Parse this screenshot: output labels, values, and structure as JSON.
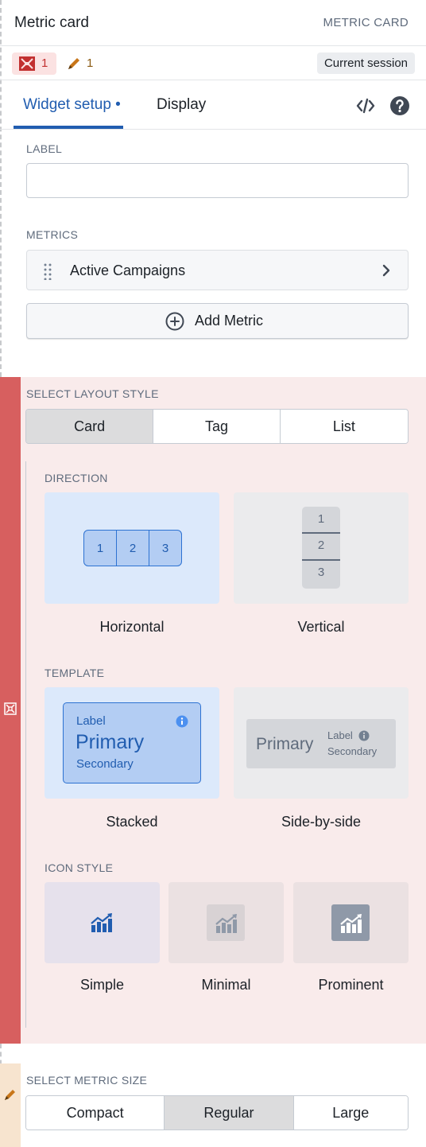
{
  "header": {
    "title": "Metric card",
    "type_label": "METRIC CARD"
  },
  "status": {
    "error_count": "1",
    "edit_count": "1",
    "session_label": "Current session"
  },
  "tabs": [
    {
      "label": "Widget setup •"
    },
    {
      "label": "Display"
    }
  ],
  "label_section": {
    "heading": "LABEL",
    "value": ""
  },
  "metrics_section": {
    "heading": "METRICS",
    "items": [
      {
        "name": "Active Campaigns"
      }
    ],
    "add_label": "Add Metric"
  },
  "layout_style": {
    "heading": "SELECT LAYOUT STYLE",
    "options": [
      "Card",
      "Tag",
      "List"
    ],
    "selected": "Card"
  },
  "direction": {
    "heading": "DIRECTION",
    "horizontal_label": "Horizontal",
    "vertical_label": "Vertical",
    "cells": [
      "1",
      "2",
      "3"
    ],
    "selected": "Horizontal"
  },
  "template": {
    "heading": "TEMPLATE",
    "stacked_label": "Stacked",
    "side_by_side_label": "Side-by-side",
    "preview": {
      "label": "Label",
      "primary": "Primary",
      "secondary": "Secondary"
    },
    "selected": "Stacked"
  },
  "icon_style": {
    "heading": "ICON STYLE",
    "options": [
      "Simple",
      "Minimal",
      "Prominent"
    ],
    "selected": "Simple"
  },
  "metric_size": {
    "heading": "SELECT METRIC SIZE",
    "options": [
      "Compact",
      "Regular",
      "Large"
    ],
    "selected": "Regular"
  },
  "colors": {
    "accent": "#215db0",
    "error": "#d75f5f",
    "error_bg": "#f9ebeb",
    "edit_bg": "#f7e4cf"
  },
  "icons": {
    "error": "error-grid-icon",
    "edit": "pencil-icon",
    "code": "code-icon",
    "help": "help-icon",
    "drag": "drag-handle-icon",
    "chevron": "chevron-right-icon",
    "add": "plus-circle-icon",
    "trend": "trend-chart-icon",
    "info": "info-icon"
  }
}
